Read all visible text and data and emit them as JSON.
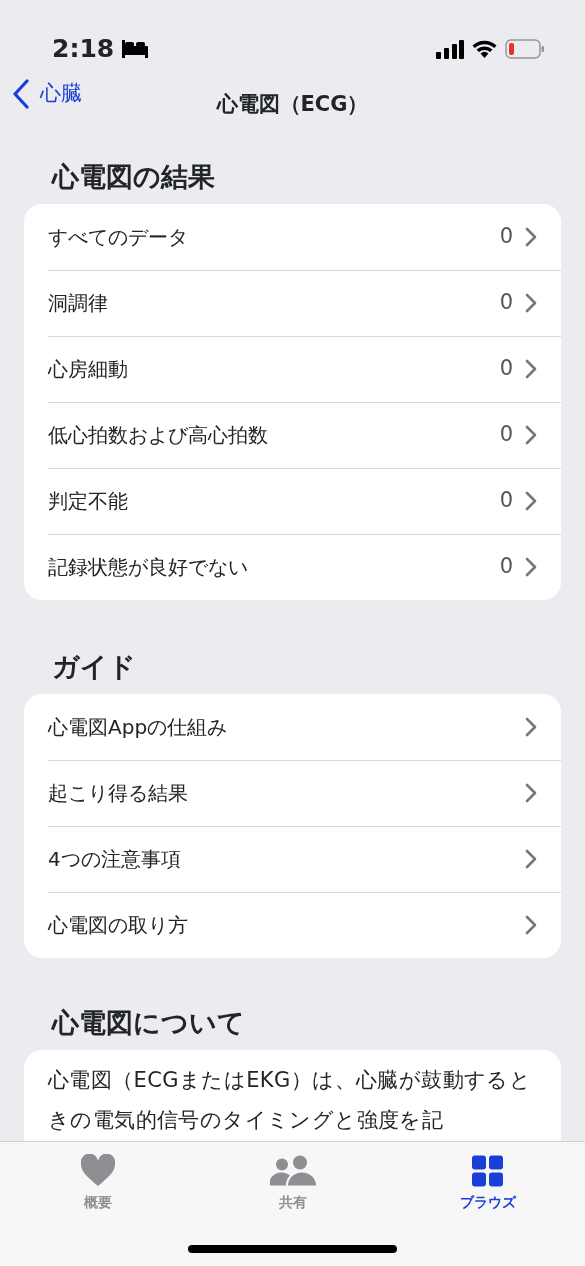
{
  "status_bar": {
    "time": "2:18"
  },
  "nav": {
    "back_label": "心臓",
    "title": "心電図（ECG）"
  },
  "sections": [
    {
      "heading": "心電図の結果",
      "rows": [
        {
          "label": "すべてのデータ",
          "count": "0"
        },
        {
          "label": "洞調律",
          "count": "0"
        },
        {
          "label": "心房細動",
          "count": "0"
        },
        {
          "label": "低心拍数および高心拍数",
          "count": "0"
        },
        {
          "label": "判定不能",
          "count": "0"
        },
        {
          "label": "記録状態が良好でない",
          "count": "0"
        }
      ]
    },
    {
      "heading": "ガイド",
      "rows": [
        {
          "label": "心電図Appの仕組み"
        },
        {
          "label": "起こり得る結果"
        },
        {
          "label": "4つの注意事項"
        },
        {
          "label": "心電図の取り方"
        }
      ]
    },
    {
      "heading": "心電図について",
      "paragraph": "心電図（ECGまたはEKG）は、心臓が鼓動するときの電気的信号のタイミングと強度を記"
    }
  ],
  "tab_bar": [
    {
      "kind": "heart",
      "label": "概要",
      "selected": false
    },
    {
      "kind": "people",
      "label": "共有",
      "selected": false
    },
    {
      "kind": "grid",
      "label": "ブラウズ",
      "selected": true
    }
  ]
}
